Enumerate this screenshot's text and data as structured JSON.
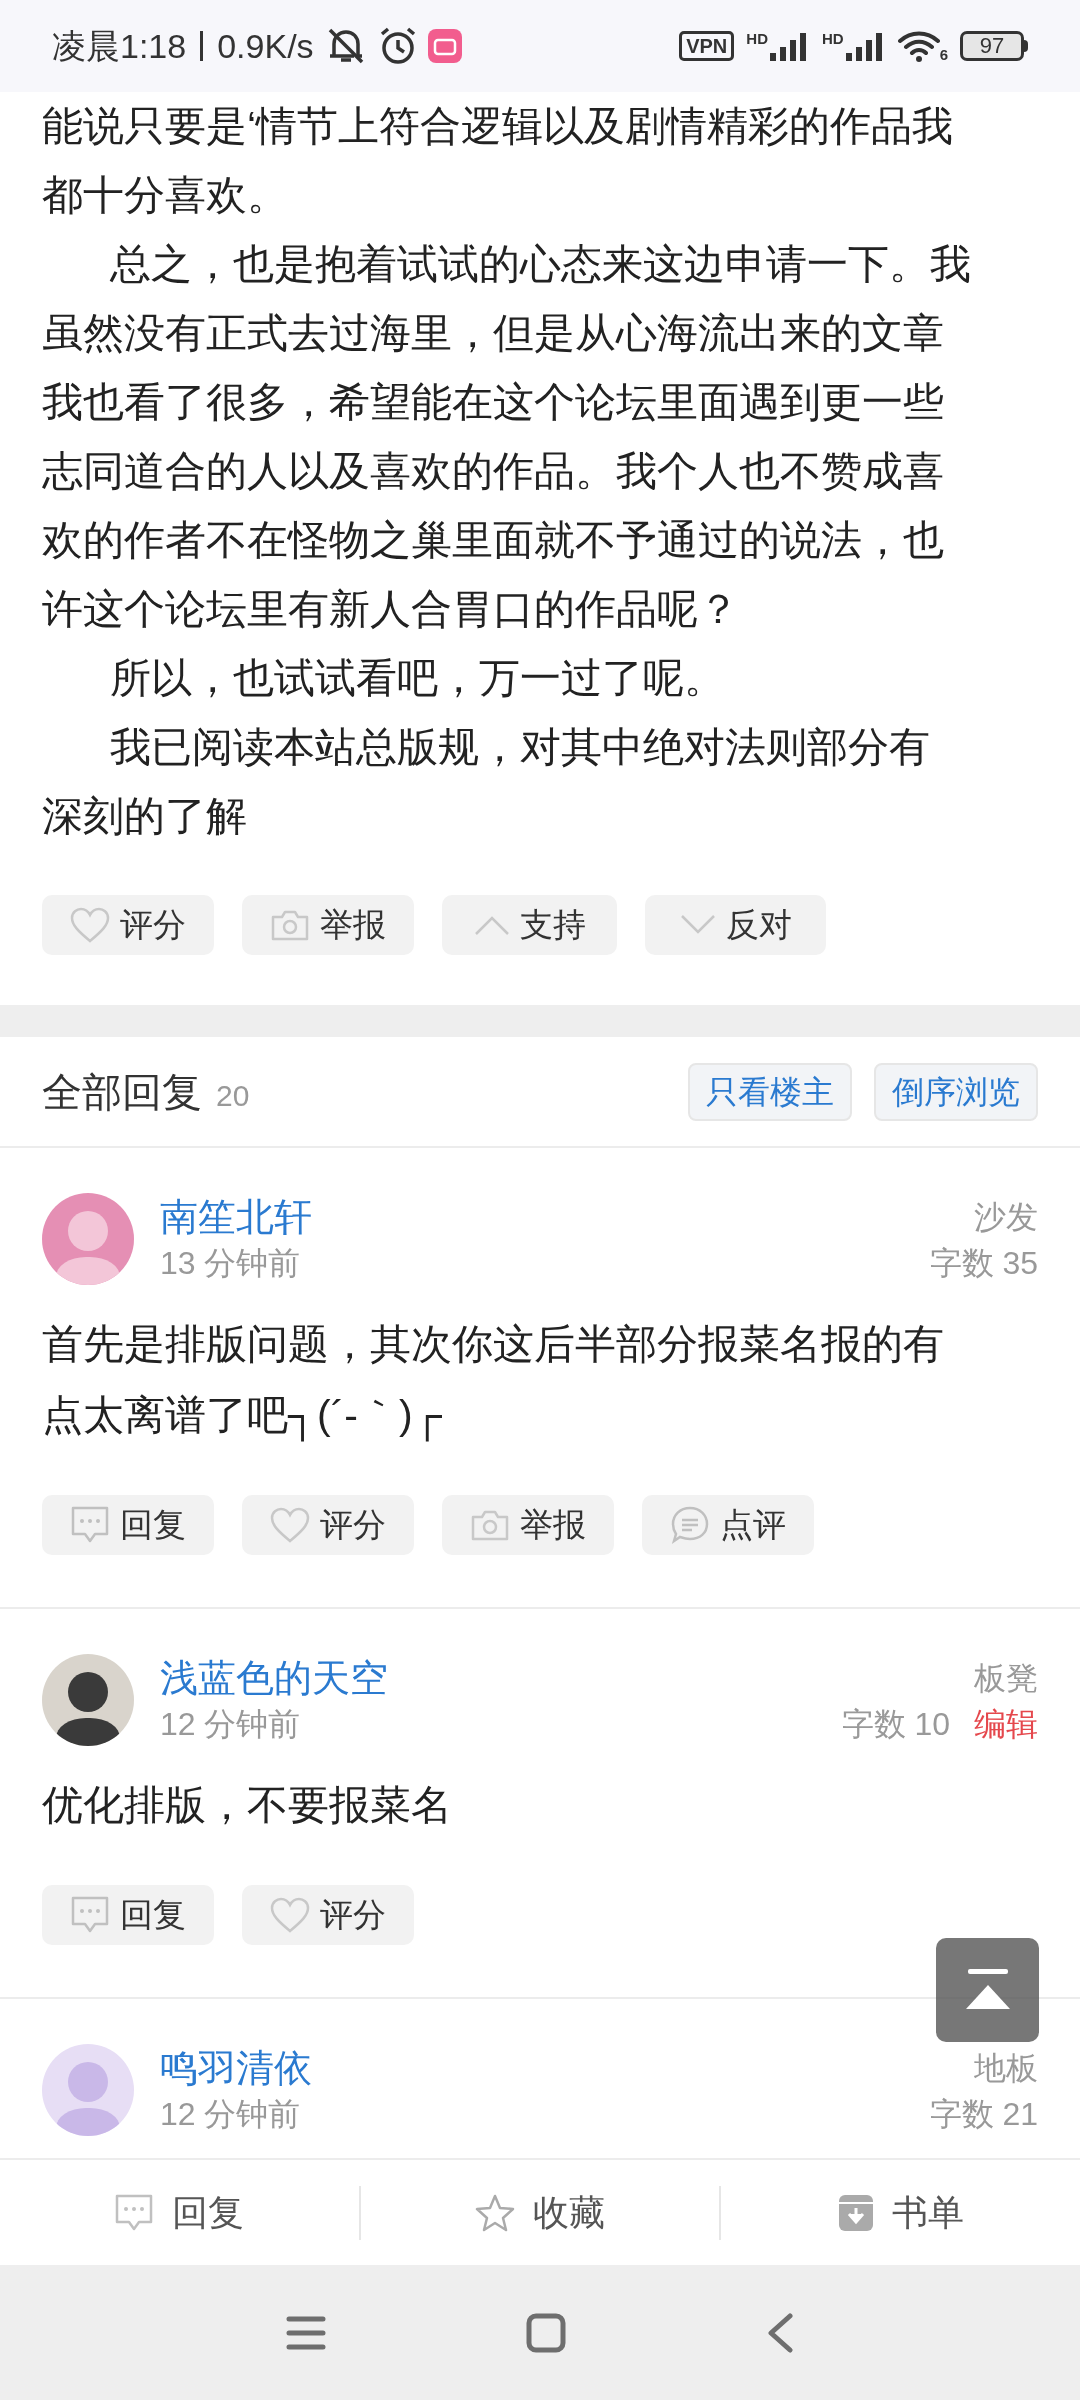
{
  "status_bar": {
    "time": "凌晨1:18",
    "speed": "0.9K/s",
    "vpn": "VPN",
    "signal_labels": [
      "HD",
      "HD"
    ],
    "wifi_label": "6",
    "battery": "97"
  },
  "post": {
    "lines": [
      {
        "text": "能说只要是‘情节上符合逻辑以及剧情精彩的作品我",
        "indent": false
      },
      {
        "text": "都十分喜欢。",
        "indent": false
      },
      {
        "text": "总之，也是抱着试试的心态来这边申请一下。我",
        "indent": true
      },
      {
        "text": "虽然没有正式去过海里，但是从心海流出来的文章",
        "indent": false
      },
      {
        "text": "我也看了很多，希望能在这个论坛里面遇到更一些",
        "indent": false
      },
      {
        "text": "志同道合的人以及喜欢的作品。我个人也不赞成喜",
        "indent": false
      },
      {
        "text": "欢的作者不在怪物之巢里面就不予通过的说法，也",
        "indent": false
      },
      {
        "text": "许这个论坛里有新人合胃口的作品呢？",
        "indent": false
      },
      {
        "text": "所以，也试试看吧，万一过了呢。",
        "indent": true
      },
      {
        "text": "我已阅读本站总版规，对其中绝对法则部分有",
        "indent": true
      },
      {
        "text": "深刻的了解",
        "indent": false
      }
    ],
    "actions": [
      {
        "kind": "heart",
        "label": "评分"
      },
      {
        "kind": "camera",
        "label": "举报"
      },
      {
        "kind": "up",
        "label": "支持"
      },
      {
        "kind": "down",
        "label": "反对"
      }
    ]
  },
  "replies_header": {
    "title": "全部回复",
    "count": "20",
    "filters": [
      "只看楼主",
      "倒序浏览"
    ]
  },
  "replies": [
    {
      "author": "南笙北轩",
      "time": "13 分钟前",
      "floor": "沙发",
      "word_count": "字数 35",
      "body_lines": [
        "首先是排版问题，其次你这后半部分报菜名报的有",
        "点太离谱了吧┐(´-｀)┌"
      ],
      "actions": [
        {
          "kind": "reply",
          "label": "回复"
        },
        {
          "kind": "heart",
          "label": "评分"
        },
        {
          "kind": "camera",
          "label": "举报"
        },
        {
          "kind": "comment",
          "label": "点评"
        }
      ]
    },
    {
      "author": "浅蓝色的天空",
      "time": "12 分钟前",
      "floor": "板凳",
      "word_count": "字数 10",
      "edit": "编辑",
      "body_lines": [
        "优化排版，不要报菜名"
      ],
      "actions": [
        {
          "kind": "reply",
          "label": "回复"
        },
        {
          "kind": "heart",
          "label": "评分"
        }
      ]
    },
    {
      "author": "鸣羽清依",
      "time": "12 分钟前",
      "floor": "地板",
      "word_count": "字数 21"
    }
  ],
  "bottom_bar": [
    {
      "kind": "reply",
      "label": "回复"
    },
    {
      "kind": "star",
      "label": "收藏"
    },
    {
      "kind": "book",
      "label": "书单"
    }
  ]
}
